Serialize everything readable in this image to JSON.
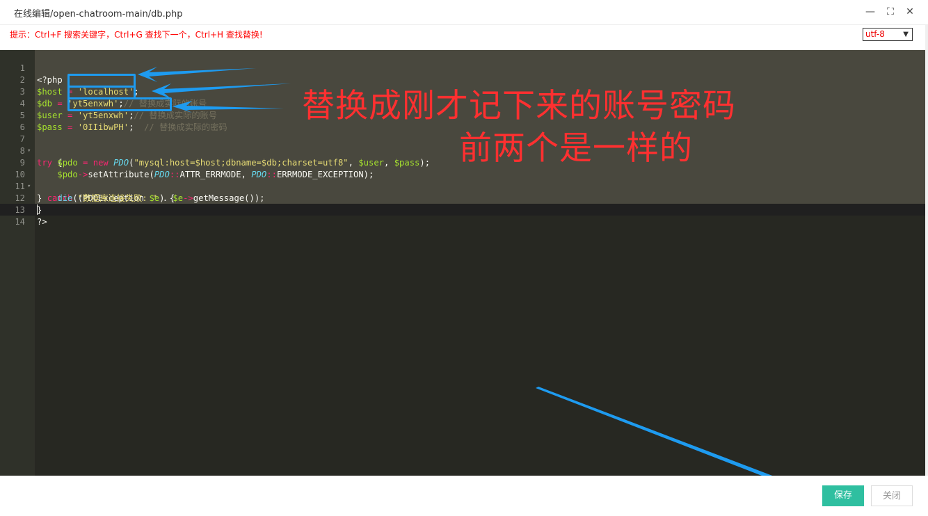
{
  "window": {
    "title": "在线编辑/open-chatroom-main/db.php",
    "minimize_icon": "—",
    "maximize_icon": "⛶",
    "close_icon": "✕"
  },
  "hint": "提示：Ctrl+F 搜索关键字，Ctrl+G 查找下一个，Ctrl+H 查找替换!",
  "encoding": {
    "selected": "utf-8"
  },
  "editor": {
    "line_numbers": [
      "1",
      "2",
      "3",
      "4",
      "5",
      "6",
      "7",
      "8",
      "9",
      "10",
      "11",
      "12",
      "13",
      "14"
    ],
    "lines": {
      "l1": [
        "<?php"
      ],
      "l2": [
        "$host",
        " = ",
        "'localhost'",
        ";"
      ],
      "l3": [
        "$db",
        " = ",
        "'yt5enxwh'",
        ";",
        "// 替换成实际的账号"
      ],
      "l4": [
        "$user",
        " = ",
        "'yt5enxwh'",
        ";",
        "// 替换成实际的账号"
      ],
      "l5": [
        "$pass",
        " = ",
        "'0IIibwPH'",
        ";  ",
        "// 替换成实际的密码"
      ],
      "l7": [
        "try",
        " {"
      ],
      "l8": [
        "    ",
        "$pdo",
        " = ",
        "new",
        " ",
        "PDO",
        "(",
        "\"mysql:host=$host;dbname=$db;charset=utf8\"",
        ", ",
        "$user",
        ", ",
        "$pass",
        ");"
      ],
      "l9": [
        "    ",
        "$pdo",
        "->",
        "setAttribute(",
        "PDO",
        "::",
        "ATTR_ERRMODE, ",
        "PDO",
        "::",
        "ERRMODE_EXCEPTION);"
      ],
      "l10": [
        "} ",
        "catch",
        " (PDOException ",
        "$e",
        ") {"
      ],
      "l11": [
        "    ",
        "die",
        "(",
        "\"数据库连接失败: \"",
        " . ",
        "$e",
        "->",
        "getMessage());"
      ],
      "l12": [
        "}"
      ],
      "l13": [
        "?>"
      ]
    }
  },
  "annotation": {
    "line1": "替换成刚才记下来的账号密码",
    "line2": "前两个是一样的"
  },
  "buttons": {
    "save": "保存",
    "close": "关闭"
  },
  "colors": {
    "accent_save": "#2fbfa0",
    "annotation_red": "#ff3030",
    "highlight_blue": "#1e9bf0"
  }
}
